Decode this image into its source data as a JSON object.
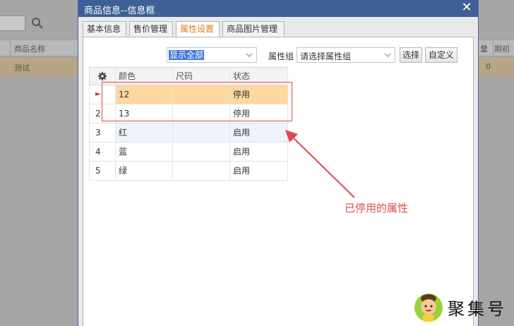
{
  "background": {
    "header_columns": [
      "商品名称",
      "量",
      "期初"
    ],
    "row": {
      "name": "测试",
      "value": "0"
    }
  },
  "dialog": {
    "title": "商品信息--信息框",
    "close_symbol": "✕",
    "tabs": [
      {
        "label": "基本信息"
      },
      {
        "label": "售价管理"
      },
      {
        "label": "属性设置",
        "active": true
      },
      {
        "label": "商品图片管理"
      }
    ],
    "filter": {
      "selected": "显示全部"
    },
    "attr_group": {
      "label": "属性组",
      "placeholder": "请选择属性组"
    },
    "buttons": {
      "choose": "选择",
      "custom": "自定义"
    },
    "grid": {
      "columns": [
        "颜色",
        "尺码",
        "状态"
      ],
      "rows": [
        {
          "num": "►",
          "color": "12",
          "size": "",
          "status": "停用",
          "selected": true
        },
        {
          "num": "2",
          "color": "13",
          "size": "",
          "status": "停用"
        },
        {
          "num": "3",
          "color": "红",
          "size": "",
          "status": "启用",
          "hover": true
        },
        {
          "num": "4",
          "color": "蓝",
          "size": "",
          "status": "启用"
        },
        {
          "num": "5",
          "color": "绿",
          "size": "",
          "status": "启用"
        }
      ]
    }
  },
  "annotation": {
    "text": "已停用的属性",
    "color": "#e04a4a"
  },
  "watermark": {
    "text": "聚集号"
  },
  "colors": {
    "titlebar": "#3e6096",
    "active_tab": "#e07b1a",
    "selected_row": "#fdd8a0"
  }
}
